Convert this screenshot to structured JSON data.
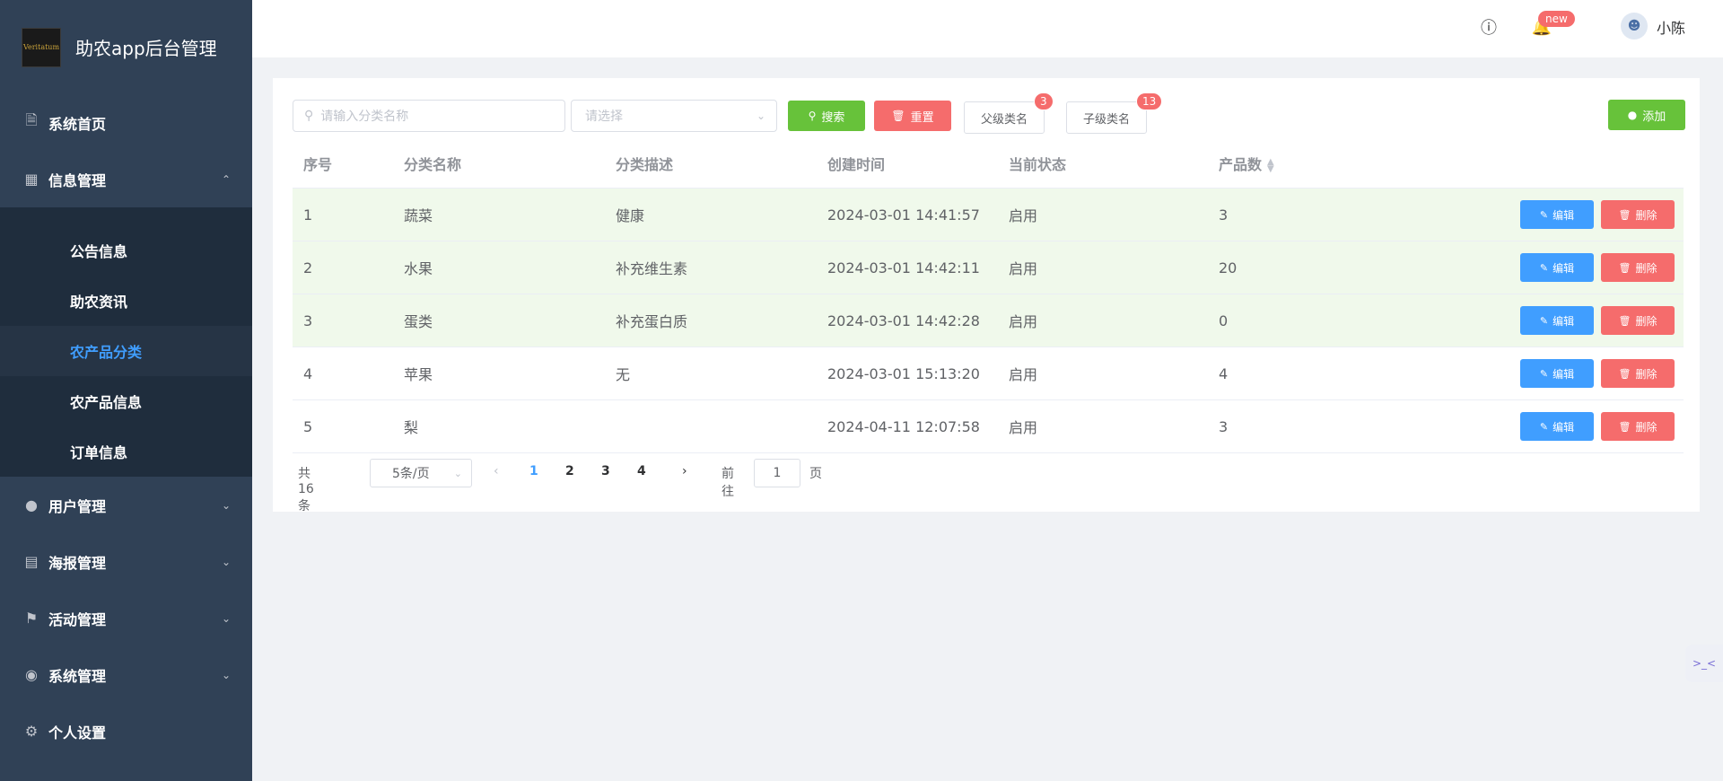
{
  "app": {
    "title": "助农app后台管理",
    "logo_text": "Veritatum"
  },
  "sidebar": {
    "items": [
      {
        "label": "系统首页",
        "icon": "document-icon"
      },
      {
        "label": "信息管理",
        "icon": "grid-icon",
        "expanded": true,
        "children": [
          {
            "label": "公告信息"
          },
          {
            "label": "助农资讯"
          },
          {
            "label": "农产品分类",
            "active": true
          },
          {
            "label": "农产品信息"
          },
          {
            "label": "订单信息"
          }
        ]
      },
      {
        "label": "用户管理",
        "icon": "user-icon"
      },
      {
        "label": "海报管理",
        "icon": "clipboard-icon"
      },
      {
        "label": "活动管理",
        "icon": "flag-icon"
      },
      {
        "label": "系统管理",
        "icon": "bulb-icon"
      },
      {
        "label": "个人设置",
        "icon": "gear-icon"
      }
    ]
  },
  "header": {
    "badge": "new",
    "username": "小陈"
  },
  "toolbar": {
    "search_placeholder": "请输入分类名称",
    "select_placeholder": "请选择",
    "search_label": "搜索",
    "reset_label": "重置",
    "parent_label": "父级类名",
    "parent_count": "3",
    "child_label": "子级类名",
    "child_count": "13",
    "add_label": "添加"
  },
  "table": {
    "headers": [
      "序号",
      "分类名称",
      "分类描述",
      "创建时间",
      "当前状态",
      "产品数"
    ],
    "edit_label": "编辑",
    "delete_label": "删除",
    "rows": [
      {
        "no": "1",
        "name": "蔬菜",
        "desc": "健康",
        "time": "2024-03-01 14:41:57",
        "status": "启用",
        "count": "3"
      },
      {
        "no": "2",
        "name": "水果",
        "desc": "补充维生素",
        "time": "2024-03-01 14:42:11",
        "status": "启用",
        "count": "20"
      },
      {
        "no": "3",
        "name": "蛋类",
        "desc": "补充蛋白质",
        "time": "2024-03-01 14:42:28",
        "status": "启用",
        "count": "0"
      },
      {
        "no": "4",
        "name": "苹果",
        "desc": "无",
        "time": "2024-03-01 15:13:20",
        "status": "启用",
        "count": "4"
      },
      {
        "no": "5",
        "name": "梨",
        "desc": "",
        "time": "2024-04-11 12:07:58",
        "status": "启用",
        "count": "3"
      }
    ]
  },
  "pagination": {
    "total": "共 16 条",
    "page_size": "5条/页",
    "pages": [
      "1",
      "2",
      "3",
      "4"
    ],
    "goto_label": "前往",
    "goto_value": "1",
    "page_label": "页"
  },
  "colors": {
    "sidebar": "#304156",
    "accent": "#409eff",
    "success": "#67c23a",
    "danger": "#f56c6c",
    "row_highlight": "#f0f9eb"
  }
}
